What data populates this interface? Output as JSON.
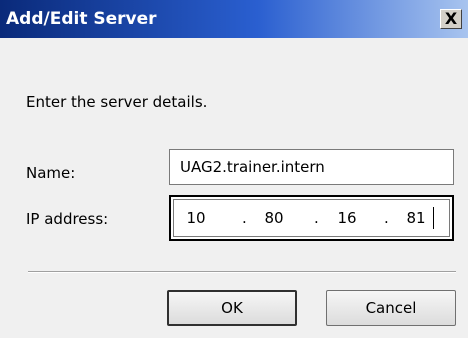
{
  "window": {
    "title": "Add/Edit Server",
    "close_glyph": "X"
  },
  "prompt": "Enter the server details.",
  "fields": {
    "name_label": "Name:",
    "name_value": "UAG2.trainer.intern",
    "ip_label": "IP address:",
    "ip_octets": [
      "10",
      "80",
      "16",
      "81"
    ],
    "ip_separator": "."
  },
  "buttons": {
    "ok_label": "OK",
    "cancel_label": "Cancel"
  },
  "colors": {
    "titlebar_start": "#0a2a7a",
    "titlebar_end": "#a8c4ef",
    "dialog_bg": "#f0f0f0"
  }
}
